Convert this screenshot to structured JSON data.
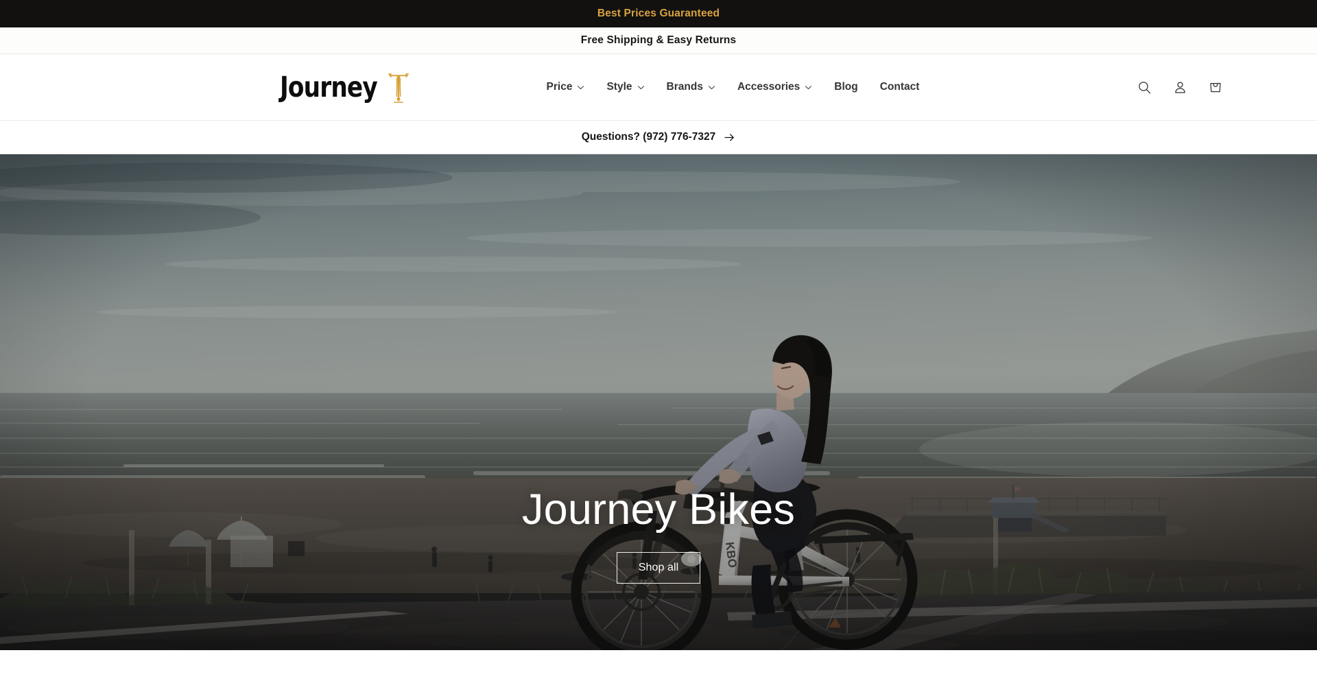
{
  "announcements": {
    "top": {
      "text": "Best Prices Guaranteed",
      "color": "#D9A340",
      "background": "#121110"
    },
    "second": {
      "text": "Free Shipping & Easy Returns",
      "color": "#171717",
      "background": "#FDFDFC"
    }
  },
  "header": {
    "logo": {
      "word": "Journey",
      "icon": "bicycle-logo-icon",
      "accent_color": "#D8A23A"
    },
    "nav": [
      {
        "label": "Price",
        "has_dropdown": true,
        "icon": "chevron-down-icon"
      },
      {
        "label": "Style",
        "has_dropdown": true,
        "icon": "chevron-down-icon"
      },
      {
        "label": "Brands",
        "has_dropdown": true,
        "icon": "chevron-down-icon"
      },
      {
        "label": "Accessories",
        "has_dropdown": true,
        "icon": "chevron-down-icon"
      },
      {
        "label": "Blog",
        "has_dropdown": false,
        "icon": ""
      },
      {
        "label": "Contact",
        "has_dropdown": false,
        "icon": ""
      }
    ],
    "actions": [
      {
        "name": "search-icon",
        "label": "Search"
      },
      {
        "name": "account-icon",
        "label": "Log in"
      },
      {
        "name": "cart-icon",
        "label": "Cart"
      }
    ]
  },
  "phone_bar": {
    "text": "Questions? (972) 776-7327",
    "icon": "arrow-right-icon"
  },
  "hero": {
    "title": "Journey Bikes",
    "button_label": "Shop all",
    "image_alt": "Woman riding a white KBO electric bike on a paved beach path at dusk with the ocean, umbrellas and a lifeguard tower behind her",
    "bike_brand_on_frame": "KBO"
  }
}
